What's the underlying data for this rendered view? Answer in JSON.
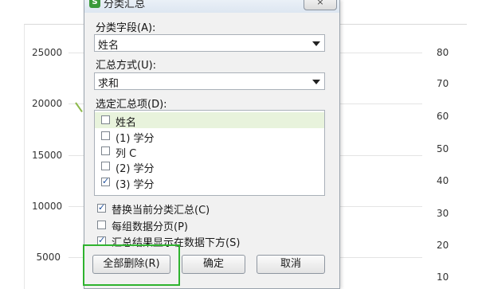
{
  "chart": {
    "left_ticks": [
      "25000",
      "20000",
      "15000",
      "10000",
      "5000"
    ],
    "right_ticks": [
      "80",
      "70",
      "60",
      "50",
      "40",
      "30",
      "20",
      "10"
    ]
  },
  "dialog": {
    "title": "分类汇总",
    "close_label": "×",
    "group_field_label": "分类字段(A):",
    "group_field_value": "姓名",
    "method_label": "汇总方式(U):",
    "method_value": "求和",
    "items_label": "选定汇总项(D):",
    "items": [
      {
        "label": "姓名",
        "checked": false,
        "selected": true
      },
      {
        "label": "(1) 学分",
        "checked": false,
        "selected": false
      },
      {
        "label": "列 C",
        "checked": false,
        "selected": false
      },
      {
        "label": "(2) 学分",
        "checked": false,
        "selected": false
      },
      {
        "label": "(3) 学分",
        "checked": true,
        "selected": false
      }
    ],
    "options": [
      {
        "label": "替换当前分类汇总(C)",
        "checked": true
      },
      {
        "label": "每组数据分页(P)",
        "checked": false
      },
      {
        "label": "汇总结果显示在数据下方(S)",
        "checked": true
      }
    ],
    "buttons": {
      "remove_all": "全部删除(R)",
      "ok": "确定",
      "cancel": "取消"
    }
  },
  "colors": {
    "highlight": "#2fb32f",
    "selected_row": "#e8f3dc"
  }
}
